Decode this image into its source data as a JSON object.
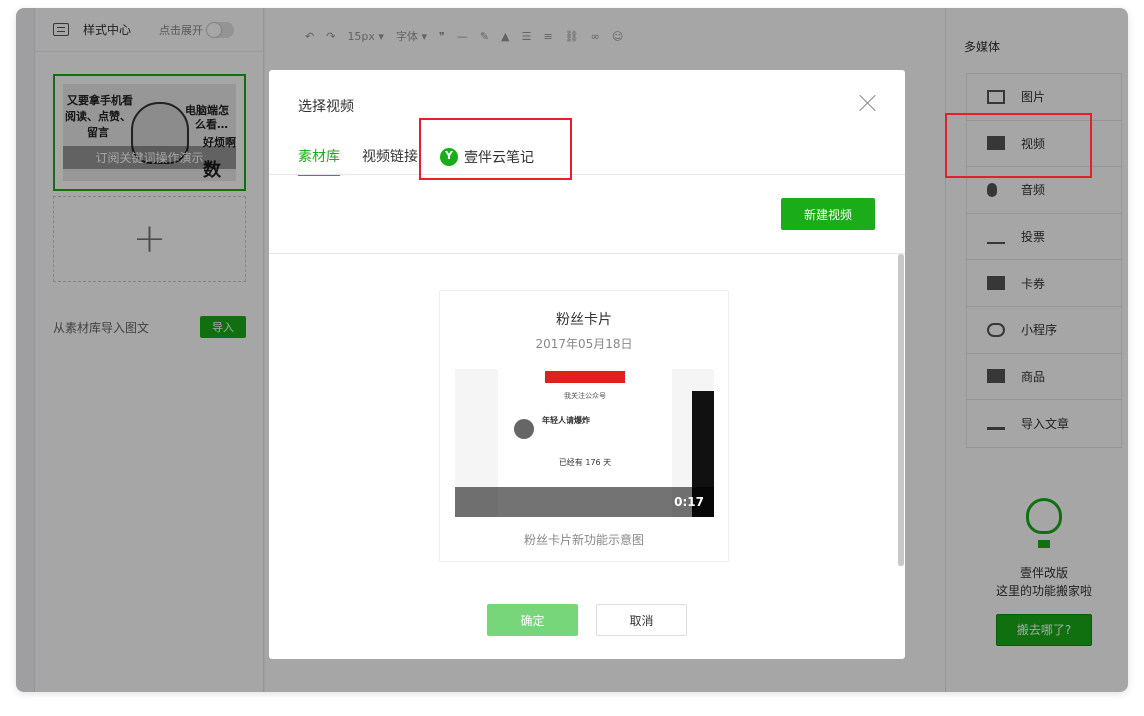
{
  "left_panel": {
    "style_center": "样式中心",
    "expand_label": "点击展开",
    "article_title": "订阅关键词操作演示",
    "import_label": "从素材库导入图文",
    "import_button": "导入"
  },
  "toolbar": {
    "font_size": "15px",
    "font_label": "字体"
  },
  "right_panel": {
    "title": "多媒体",
    "items": [
      {
        "label": "图片",
        "icon": "image-icon"
      },
      {
        "label": "视频",
        "icon": "video-icon"
      },
      {
        "label": "音频",
        "icon": "microphone-icon"
      },
      {
        "label": "投票",
        "icon": "bar-chart-icon"
      },
      {
        "label": "卡券",
        "icon": "wallet-icon"
      },
      {
        "label": "小程序",
        "icon": "mini-program-icon"
      },
      {
        "label": "商品",
        "icon": "shop-icon"
      },
      {
        "label": "导入文章",
        "icon": "download-icon"
      }
    ],
    "promo_line1": "壹伴改版",
    "promo_line2": "这里的功能搬家啦",
    "promo_button": "搬去哪了?"
  },
  "modal": {
    "title": "选择视频",
    "tabs": [
      {
        "label": "素材库",
        "active": true
      },
      {
        "label": "视频链接",
        "active": false
      },
      {
        "label": "壹伴云笔记",
        "active": false
      }
    ],
    "new_video_button": "新建视频",
    "video": {
      "title": "粉丝卡片",
      "date": "2017年05月18日",
      "duration": "0:17",
      "caption": "粉丝卡片新功能示意图",
      "inner_follow": "我关注公众号",
      "inner_name": "年轻人请爆炸",
      "inner_days": "已经有 176 天"
    },
    "ok_button": "确定",
    "cancel_button": "取消"
  },
  "colors": {
    "accent": "#1aad19",
    "highlight": "#e5202b"
  }
}
